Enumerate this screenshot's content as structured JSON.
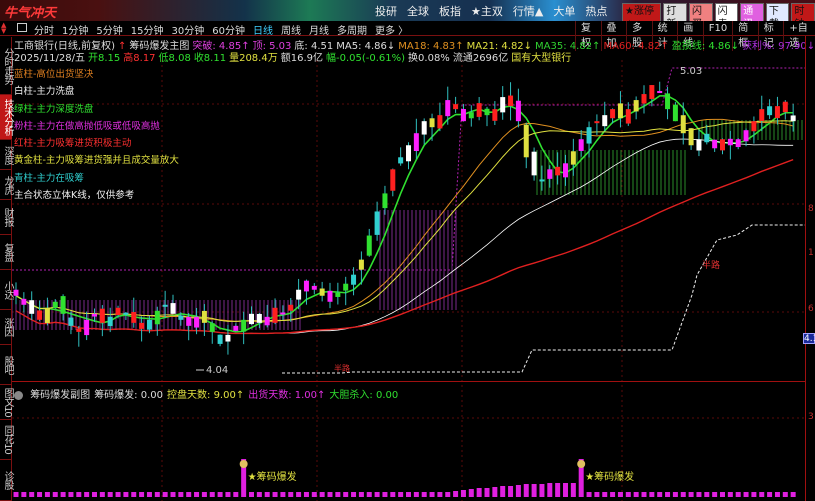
{
  "app": {
    "logo_text": "牛气冲天",
    "nav": [
      "投研",
      "全球",
      "板指",
      "★主双",
      "行情▲",
      "大单",
      "热点"
    ],
    "quick_buttons": [
      {
        "label": "★涨停★",
        "bg": "#c01818",
        "fg": "#111"
      },
      {
        "label": "打新",
        "bg": "#ddd",
        "fg": "#111"
      },
      {
        "label": "闪买",
        "bg": "#f08080",
        "fg": "#111"
      },
      {
        "label": "闪卖",
        "bg": "#fff",
        "fg": "#111"
      },
      {
        "label": "通讯",
        "bg": "#e060e0",
        "fg": "#fff"
      },
      {
        "label": "下载",
        "bg": "#e0e8ff",
        "fg": "#111"
      },
      {
        "label": "时钟",
        "bg": "#c01818",
        "fg": "#111"
      }
    ]
  },
  "period_tabs": [
    "分时",
    "1分钟",
    "5分钟",
    "15分钟",
    "30分钟",
    "60分钟",
    "日线",
    "周线",
    "月线",
    "多周期",
    "更多 〉"
  ],
  "active_tab": "日线",
  "tools": [
    "复权",
    "叠加",
    "多股",
    "统计",
    "画线",
    "F10",
    "简框",
    "标记",
    "+自选"
  ],
  "sidebar": [
    "分时走势",
    "技术分析",
    "深度",
    "龙虎",
    "财报",
    "复盘",
    "小达",
    "涨因",
    "股吧",
    "图文10",
    "同花10",
    "诊股"
  ],
  "sidebar_active": "技术分析",
  "info_line1": [
    {
      "t": "工商银行(日线,前复权)",
      "c": "#ddd"
    },
    {
      "t": "↑",
      "c": "#ff3030"
    },
    {
      "t": "筹码爆发主图",
      "c": "#ddd"
    },
    {
      "t": "突破: 4.85↑",
      "c": "#e040e0"
    },
    {
      "t": "顶: 5.03",
      "c": "#e040e0"
    },
    {
      "t": "底: 4.51",
      "c": "#ddd"
    },
    {
      "t": "MA5: 4.86↓",
      "c": "#ddd"
    },
    {
      "t": "MA18: 4.83↑",
      "c": "#e09020"
    },
    {
      "t": "MA21: 4.82↓",
      "c": "#e0e040"
    },
    {
      "t": "MA35: 4.82↑",
      "c": "#30d030"
    },
    {
      "t": "MA60: 4.82↑",
      "c": "#e02020"
    },
    {
      "t": "盈损线: 4.86↓",
      "c": "#30e030"
    },
    {
      "t": "获利%: 97.90↓",
      "c": "#b030e0"
    }
  ],
  "info_line2": [
    {
      "t": "2025/11/28/五",
      "c": "#ddd"
    },
    {
      "t": "开8.15",
      "c": "#30e030"
    },
    {
      "t": "高8.17",
      "c": "#ff3030"
    },
    {
      "t": "低8.08",
      "c": "#30e030"
    },
    {
      "t": "收8.11",
      "c": "#30e030"
    },
    {
      "t": "量208.4万",
      "c": "#e0e040"
    },
    {
      "t": "额16.9亿",
      "c": "#ddd"
    },
    {
      "t": "幅-0.05(-0.61%)",
      "c": "#30e030"
    },
    {
      "t": "换0.08%",
      "c": "#ddd"
    },
    {
      "t": "流通2696亿",
      "c": "#ddd"
    },
    {
      "t": "国有大型银行",
      "c": "#e0e040"
    }
  ],
  "legend": [
    {
      "t": "蓝柱-高位出货坚决",
      "c": "#e08020"
    },
    {
      "t": "白柱-主力洗盘",
      "c": "#eee"
    },
    {
      "t": "绿柱-主力深度洗盘",
      "c": "#30e030"
    },
    {
      "t": "粉柱-主力在做高抛低吸或低吸高抛",
      "c": "#e030e0"
    },
    {
      "t": "红柱-主力吸筹进货积极主动",
      "c": "#ff3030"
    },
    {
      "t": "黄金柱-主力吸筹进货强并且成交量放大",
      "c": "#e0e040"
    },
    {
      "t": "青柱-主力在吸筹",
      "c": "#30d0d0"
    },
    {
      "t": "主合状态立体K线，仅供参考",
      "c": "#eee"
    }
  ],
  "annotations": {
    "high_label": "5.03",
    "low_label": "4.04",
    "half_label": "半路",
    "half_label2": "半路"
  },
  "axis_labels": [
    "8",
    "6",
    "3",
    "1"
  ],
  "price_tag": "4.1",
  "sub_header": [
    {
      "t": "筹码爆发副图",
      "c": "#ddd"
    },
    {
      "t": "筹码爆发: 0.00",
      "c": "#ddd"
    },
    {
      "t": "控盘天数: 9.00↑",
      "c": "#e0e040"
    },
    {
      "t": "出货天数: 1.00↑",
      "c": "#e030e0"
    },
    {
      "t": "大胆杀入: 0.00",
      "c": "#30e030"
    }
  ],
  "sub_signal_label": "★筹码爆发",
  "chart_data": {
    "type": "candlestick",
    "closes": [
      4.28,
      4.25,
      4.22,
      4.2,
      4.24,
      4.26,
      4.22,
      4.18,
      4.16,
      4.2,
      4.22,
      4.19,
      4.21,
      4.24,
      4.22,
      4.19,
      4.17,
      4.2,
      4.23,
      4.25,
      4.22,
      4.2,
      4.18,
      4.21,
      4.19,
      4.16,
      4.12,
      4.15,
      4.18,
      4.2,
      4.22,
      4.19,
      4.21,
      4.24,
      4.22,
      4.25,
      4.3,
      4.33,
      4.3,
      4.28,
      4.26,
      4.29,
      4.32,
      4.35,
      4.4,
      4.48,
      4.56,
      4.62,
      4.7,
      4.74,
      4.78,
      4.82,
      4.86,
      4.84,
      4.88,
      4.93,
      4.9,
      4.86,
      4.89,
      4.92,
      4.88,
      4.9,
      4.94,
      4.91,
      4.86,
      4.74,
      4.68,
      4.66,
      4.7,
      4.68,
      4.72,
      4.76,
      4.8,
      4.84,
      4.86,
      4.88,
      4.9,
      4.87,
      4.9,
      4.93,
      4.95,
      4.98,
      4.96,
      4.9,
      4.86,
      4.82,
      4.78,
      4.8,
      4.79,
      4.77,
      4.8,
      4.78,
      4.8,
      4.83,
      4.86,
      4.9,
      4.88,
      4.91,
      4.89,
      4.86
    ],
    "high": 5.03,
    "low": 4.04,
    "colors": [
      "#ff20ff",
      "#ffffff",
      "#ff2020",
      "#e0e040",
      "#30d0d0",
      "#30e030"
    ]
  }
}
